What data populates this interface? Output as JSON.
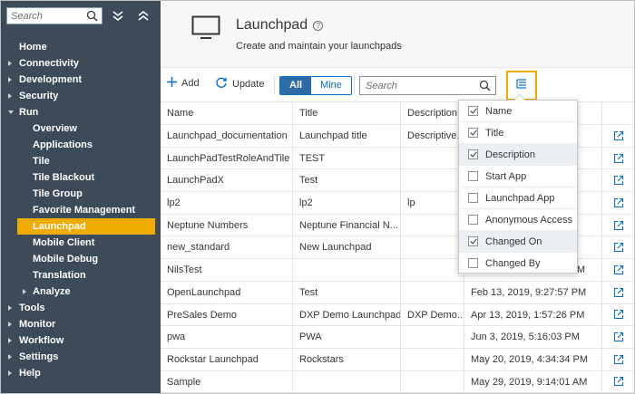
{
  "sidebar": {
    "search_placeholder": "Search",
    "items": [
      {
        "label": "Home",
        "level": 0,
        "caret": "none"
      },
      {
        "label": "Connectivity",
        "level": 0,
        "caret": "right"
      },
      {
        "label": "Development",
        "level": 0,
        "caret": "right"
      },
      {
        "label": "Security",
        "level": 0,
        "caret": "right"
      },
      {
        "label": "Run",
        "level": 0,
        "caret": "down"
      },
      {
        "label": "Overview",
        "level": 1,
        "caret": "none"
      },
      {
        "label": "Applications",
        "level": 1,
        "caret": "none"
      },
      {
        "label": "Tile",
        "level": 1,
        "caret": "none"
      },
      {
        "label": "Tile Blackout",
        "level": 1,
        "caret": "none"
      },
      {
        "label": "Tile Group",
        "level": 1,
        "caret": "none"
      },
      {
        "label": "Favorite Management",
        "level": 1,
        "caret": "none"
      },
      {
        "label": "Launchpad",
        "level": 1,
        "caret": "none",
        "active": true
      },
      {
        "label": "Mobile Client",
        "level": 1,
        "caret": "none"
      },
      {
        "label": "Mobile Debug",
        "level": 1,
        "caret": "none"
      },
      {
        "label": "Translation",
        "level": 1,
        "caret": "none"
      },
      {
        "label": "Analyze",
        "level": 1,
        "caret": "right"
      },
      {
        "label": "Tools",
        "level": 0,
        "caret": "right"
      },
      {
        "label": "Monitor",
        "level": 0,
        "caret": "right"
      },
      {
        "label": "Workflow",
        "level": 0,
        "caret": "right"
      },
      {
        "label": "Settings",
        "level": 0,
        "caret": "right"
      },
      {
        "label": "Help",
        "level": 0,
        "caret": "right"
      }
    ]
  },
  "header": {
    "title": "Launchpad",
    "subtitle": "Create and maintain your launchpads"
  },
  "toolbar": {
    "add_label": "Add",
    "update_label": "Update",
    "all_label": "All",
    "mine_label": "Mine",
    "search_placeholder": "Search"
  },
  "table": {
    "columns": [
      "Name",
      "Title",
      "Description",
      "",
      ""
    ],
    "rows": [
      [
        "Launchpad_documentation",
        "Launchpad title",
        "Descriptive...",
        ""
      ],
      [
        "LaunchPadTestRoleAndTile",
        "TEST",
        "",
        ""
      ],
      [
        "LaunchPadX",
        "Test",
        "",
        ""
      ],
      [
        "lp2",
        "lp2",
        "lp",
        ""
      ],
      [
        "Neptune Numbers",
        "Neptune Financial N...",
        "",
        ""
      ],
      [
        "new_standard",
        "New Launchpad",
        "",
        ""
      ],
      [
        "NilsTest",
        "",
        "",
        "Jun 13, 2019, 3:23:43 PM"
      ],
      [
        "OpenLaunchpad",
        "Test",
        "",
        "Feb 13, 2019, 9:27:57 PM"
      ],
      [
        "PreSales Demo",
        "DXP Demo Launchpad",
        "DXP Demo...",
        "Apr 13, 2019, 1:57:26 PM"
      ],
      [
        "pwa",
        "PWA",
        "",
        "Jun 3, 2019, 5:16:03 PM"
      ],
      [
        "Rockstar Launchpad",
        "Rockstars",
        "",
        "May 20, 2019, 4:34:34 PM"
      ],
      [
        "Sample",
        "",
        "",
        "May 29, 2019, 9:14:01 AM"
      ]
    ]
  },
  "column_popover": {
    "items": [
      {
        "label": "Name",
        "checked": true
      },
      {
        "label": "Title",
        "checked": true
      },
      {
        "label": "Description",
        "checked": true
      },
      {
        "label": "Start App",
        "checked": false
      },
      {
        "label": "Launchpad App",
        "checked": false
      },
      {
        "label": "Anonymous Access",
        "checked": false
      },
      {
        "label": "Changed On",
        "checked": true
      },
      {
        "label": "Changed By",
        "checked": false
      }
    ]
  },
  "colors": {
    "sidebar_bg": "#3d4b59",
    "active_item": "#f0ab00",
    "accent": "#0a6ed1"
  }
}
